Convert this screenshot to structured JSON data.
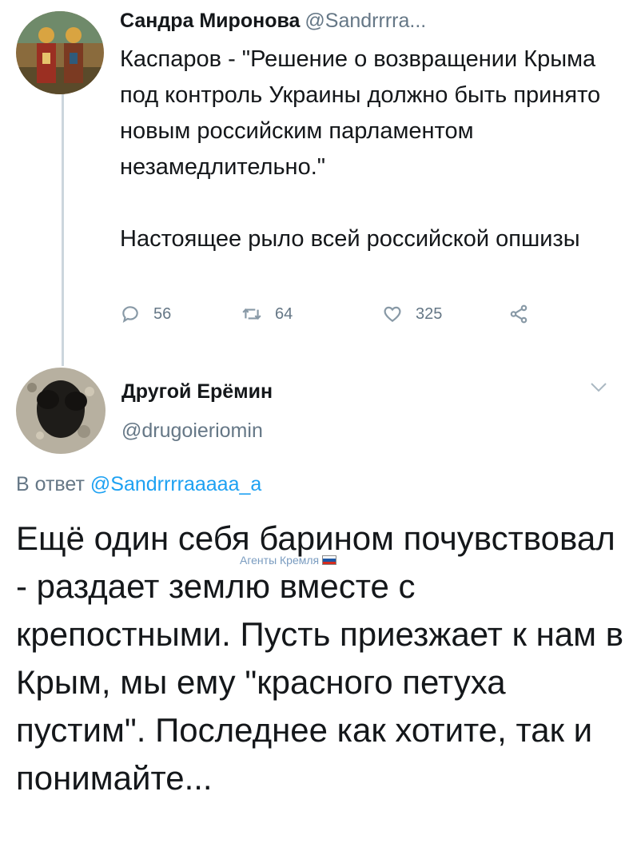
{
  "tweet1": {
    "name": "Сандра Миронова",
    "handle": "@Sandrrrra...",
    "paragraph1": "Каспаров  - \"Решение о возвращении Крыма под контроль Украины должно быть принято новым российским парламентом незамедлительно.\"",
    "paragraph2": "Настоящее рыло всей российской опшизы",
    "actions": {
      "replies": "56",
      "retweets": "64",
      "likes": "325"
    }
  },
  "tweet2": {
    "name": "Другой Ерёмин",
    "handle": "@drugoieriomin",
    "reply_prefix": "В ответ",
    "reply_mention": "@Sandrrrraaaaa_a",
    "text": "Ещё один себя барином почувствовал - раздает землю вместе с крепостными. Пусть приезжает к нам в Крым, мы ему \"красного петуха пустим\". Последнее как хотите, так и понимайте..."
  },
  "watermark": "Агенты Кремля",
  "icons": [
    "reply-icon",
    "retweet-icon",
    "like-icon",
    "share-icon",
    "chevron-down-icon",
    "russian-flag-icon"
  ],
  "colors": {
    "text": "#14171a",
    "secondary": "#657786",
    "link": "#1da1f2",
    "thread_line": "#ccd6dd"
  }
}
